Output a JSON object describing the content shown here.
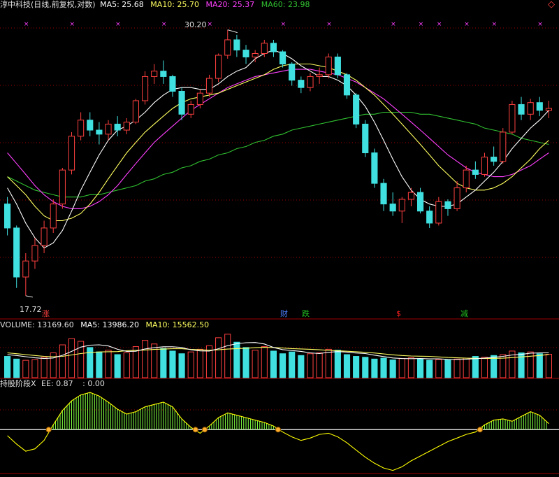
{
  "header": {
    "title": "淳中科技(日线,前复权,对数)",
    "ma5_label": "MA5: 25.68",
    "ma10_label": "MA10: 25.70",
    "ma20_label": "MA20: 25.37",
    "ma60_label": "MA60: 23.98",
    "corner_icon": "diamond-icon"
  },
  "price_panel": {
    "high_annotation": "30.20",
    "low_annotation": "17.72",
    "markers": [
      {
        "label": "涨",
        "color": "#ff4040"
      },
      {
        "label": "财",
        "color": "#4a7fff"
      },
      {
        "label": "跌",
        "color": "#20c020"
      },
      {
        "label": "$",
        "color": "#ff2020"
      },
      {
        "label": "减",
        "color": "#20c020"
      }
    ]
  },
  "volume_panel": {
    "volume_label": "VOLUME: 13169.60",
    "ma5_label": "MA5: 13986.20",
    "ma10_label": "MA10: 15562.50"
  },
  "indicator_panel": {
    "name_label": "持股阶段X",
    "ee_label": "EE: 0.87",
    "value_label": ": 0.00"
  },
  "colors": {
    "up": "#ff4040",
    "down": "#40e0e0",
    "ma5": "#ffffff",
    "ma10": "#ffff60",
    "ma20": "#ff40ff",
    "ma60": "#30c030",
    "indicator_line": "#ffff00",
    "indicator_bars": "#80ff40",
    "grid": "#a00000"
  },
  "chart_data": {
    "type": "candlestick",
    "title": "淳中科技(日线,前复权,对数)",
    "y_range": [
      17.72,
      30.2
    ],
    "ohlc": [
      [
        21.3,
        21.6,
        20.0,
        20.3
      ],
      [
        20.3,
        20.4,
        18.0,
        18.4
      ],
      [
        18.4,
        19.3,
        17.72,
        19.0
      ],
      [
        19.0,
        19.9,
        18.7,
        19.6
      ],
      [
        19.6,
        20.6,
        19.3,
        20.3
      ],
      [
        20.3,
        21.5,
        20.1,
        21.3
      ],
      [
        21.3,
        22.9,
        21.1,
        22.8
      ],
      [
        22.8,
        24.6,
        22.6,
        24.4
      ],
      [
        24.4,
        25.6,
        24.2,
        25.2
      ],
      [
        25.2,
        25.6,
        24.4,
        24.7
      ],
      [
        24.7,
        25.1,
        24.0,
        24.5
      ],
      [
        24.5,
        25.2,
        24.2,
        25.0
      ],
      [
        25.0,
        25.4,
        24.4,
        24.7
      ],
      [
        24.7,
        25.3,
        24.5,
        25.1
      ],
      [
        25.1,
        26.3,
        25.0,
        26.2
      ],
      [
        26.2,
        27.8,
        26.0,
        27.5
      ],
      [
        27.5,
        28.2,
        27.1,
        27.8
      ],
      [
        27.8,
        28.4,
        27.1,
        27.5
      ],
      [
        27.5,
        27.6,
        26.4,
        26.7
      ],
      [
        26.7,
        26.9,
        25.2,
        25.5
      ],
      [
        25.5,
        26.2,
        25.3,
        26.0
      ],
      [
        26.0,
        26.8,
        25.8,
        26.6
      ],
      [
        26.6,
        27.6,
        26.4,
        27.4
      ],
      [
        27.4,
        28.8,
        27.2,
        28.7
      ],
      [
        28.7,
        30.2,
        28.5,
        29.6
      ],
      [
        29.6,
        29.9,
        28.6,
        29.0
      ],
      [
        29.0,
        29.3,
        28.2,
        28.6
      ],
      [
        28.6,
        29.0,
        28.3,
        28.8
      ],
      [
        28.8,
        29.6,
        28.6,
        29.4
      ],
      [
        29.4,
        29.6,
        28.6,
        28.9
      ],
      [
        28.9,
        29.0,
        28.0,
        28.2
      ],
      [
        28.2,
        28.3,
        27.0,
        27.3
      ],
      [
        27.3,
        27.5,
        26.6,
        26.9
      ],
      [
        26.9,
        27.7,
        26.7,
        27.5
      ],
      [
        27.5,
        28.0,
        27.1,
        27.6
      ],
      [
        27.6,
        28.8,
        27.4,
        28.6
      ],
      [
        28.6,
        28.8,
        27.4,
        27.6
      ],
      [
        27.6,
        27.7,
        26.3,
        26.5
      ],
      [
        26.5,
        26.6,
        24.8,
        25.0
      ],
      [
        25.0,
        25.2,
        23.4,
        23.6
      ],
      [
        23.6,
        23.8,
        22.0,
        22.2
      ],
      [
        22.2,
        22.4,
        21.0,
        21.3
      ],
      [
        21.3,
        21.8,
        20.8,
        21.0
      ],
      [
        21.0,
        21.6,
        20.5,
        21.5
      ],
      [
        21.5,
        22.0,
        21.2,
        21.8
      ],
      [
        21.8,
        22.0,
        20.9,
        21.0
      ],
      [
        21.0,
        21.2,
        20.3,
        20.5
      ],
      [
        20.5,
        21.6,
        20.4,
        21.4
      ],
      [
        21.4,
        21.5,
        20.8,
        21.1
      ],
      [
        21.1,
        22.3,
        21.0,
        22.0
      ],
      [
        22.0,
        23.0,
        21.8,
        22.8
      ],
      [
        22.8,
        23.2,
        22.4,
        22.6
      ],
      [
        22.6,
        23.6,
        22.5,
        23.4
      ],
      [
        23.4,
        23.9,
        23.0,
        23.2
      ],
      [
        23.2,
        24.8,
        23.1,
        24.6
      ],
      [
        24.6,
        26.2,
        24.5,
        26.0
      ],
      [
        26.0,
        26.4,
        25.2,
        25.5
      ],
      [
        25.5,
        26.3,
        25.2,
        26.1
      ],
      [
        26.1,
        26.4,
        25.4,
        25.7
      ],
      [
        25.7,
        26.2,
        25.3,
        25.8
      ]
    ],
    "ma5": [
      22.0,
      21.3,
      20.5,
      19.9,
      19.5,
      19.7,
      20.2,
      21.0,
      21.9,
      22.7,
      23.5,
      24.2,
      24.7,
      24.9,
      25.2,
      25.6,
      26.1,
      26.5,
      26.8,
      26.9,
      26.9,
      26.8,
      26.8,
      27.1,
      27.5,
      27.8,
      28.0,
      28.5,
      28.8,
      29.0,
      28.8,
      28.5,
      28.1,
      27.8,
      27.5,
      27.5,
      27.3,
      27.0,
      26.5,
      25.9,
      25.1,
      24.2,
      23.3,
      22.5,
      21.9,
      21.5,
      21.3,
      21.2,
      21.2,
      21.3,
      21.6,
      21.9,
      22.3,
      22.7,
      23.2,
      23.8,
      24.3,
      24.8,
      25.2,
      25.7
    ],
    "ma10": [
      22.5,
      22.1,
      21.7,
      21.2,
      20.8,
      20.6,
      20.6,
      20.7,
      20.9,
      21.3,
      21.8,
      22.4,
      23.0,
      23.6,
      24.1,
      24.6,
      25.0,
      25.4,
      25.8,
      26.1,
      26.3,
      26.4,
      26.5,
      26.6,
      26.8,
      27.0,
      27.2,
      27.4,
      27.6,
      27.9,
      28.1,
      28.2,
      28.2,
      28.2,
      28.1,
      28.0,
      27.8,
      27.6,
      27.3,
      26.9,
      26.5,
      26.0,
      25.5,
      25.0,
      24.5,
      24.0,
      23.5,
      23.0,
      22.6,
      22.2,
      22.0,
      21.9,
      21.9,
      22.0,
      22.2,
      22.5,
      22.9,
      23.3,
      23.8,
      24.2
    ],
    "ma20": [
      23.6,
      23.1,
      22.6,
      22.1,
      21.7,
      21.4,
      21.2,
      21.1,
      21.1,
      21.2,
      21.4,
      21.7,
      22.1,
      22.6,
      23.1,
      23.6,
      24.1,
      24.5,
      24.9,
      25.3,
      25.7,
      26.0,
      26.3,
      26.6,
      26.9,
      27.1,
      27.3,
      27.5,
      27.6,
      27.7,
      27.8,
      27.9,
      27.9,
      27.9,
      27.8,
      27.7,
      27.6,
      27.4,
      27.2,
      26.9,
      26.6,
      26.3,
      25.9,
      25.5,
      25.1,
      24.7,
      24.3,
      23.9,
      23.5,
      23.2,
      22.9,
      22.7,
      22.6,
      22.5,
      22.5,
      22.6,
      22.8,
      23.0,
      23.3,
      23.6
    ],
    "ma60": [
      22.5,
      22.3,
      22.1,
      21.9,
      21.8,
      21.7,
      21.6,
      21.6,
      21.6,
      21.7,
      21.7,
      21.8,
      21.9,
      22.0,
      22.1,
      22.3,
      22.4,
      22.6,
      22.7,
      22.9,
      23.0,
      23.2,
      23.3,
      23.5,
      23.6,
      23.8,
      23.9,
      24.1,
      24.2,
      24.4,
      24.5,
      24.7,
      24.8,
      24.9,
      25.0,
      25.1,
      25.2,
      25.3,
      25.4,
      25.5,
      25.5,
      25.6,
      25.6,
      25.6,
      25.6,
      25.5,
      25.5,
      25.4,
      25.3,
      25.2,
      25.1,
      25.0,
      24.8,
      24.7,
      24.6,
      24.5,
      24.3,
      24.2,
      24.1,
      24.0
    ],
    "volume": [
      12000,
      10500,
      9800,
      10200,
      11500,
      14000,
      18500,
      22000,
      20500,
      17000,
      14500,
      15500,
      13000,
      14000,
      17500,
      21000,
      19000,
      16500,
      15000,
      13500,
      14500,
      16000,
      18000,
      22500,
      24500,
      20000,
      17000,
      15500,
      17500,
      15000,
      13500,
      14500,
      12500,
      13500,
      14000,
      16000,
      15500,
      13000,
      12000,
      11500,
      10500,
      11000,
      10000,
      10800,
      11200,
      10500,
      9800,
      10200,
      10000,
      10500,
      11000,
      12000,
      11500,
      12500,
      13000,
      15000,
      14000,
      14500,
      13500,
      13169.6
    ],
    "volume_ma5": [
      13000,
      12500,
      11800,
      11200,
      10800,
      11100,
      12600,
      14800,
      17200,
      18300,
      18500,
      17900,
      16000,
      14800,
      14900,
      16200,
      16900,
      17400,
      17400,
      17000,
      15700,
      15100,
      15000,
      16300,
      18100,
      19100,
      19700,
      19800,
      19000,
      17000,
      15800,
      15300,
      14800,
      14000,
      13600,
      14300,
      14700,
      14400,
      13900,
      13600,
      12700,
      11900,
      11100,
      10800,
      10700,
      10800,
      10600,
      10600,
      10300,
      10200,
      10400,
      10700,
      11000,
      11500,
      12000,
      12800,
      13100,
      13800,
      14000,
      13986.2
    ],
    "volume_ma10": [
      14000,
      13500,
      13000,
      12500,
      12000,
      11800,
      12000,
      12800,
      13600,
      14200,
      14500,
      14600,
      14700,
      15200,
      15400,
      15600,
      15900,
      16100,
      16300,
      16300,
      15900,
      15700,
      15500,
      15700,
      16100,
      16400,
      16600,
      16900,
      17100,
      17000,
      16700,
      16400,
      16200,
      16000,
      15700,
      15400,
      15200,
      14900,
      14600,
      14300,
      13900,
      13400,
      12900,
      12500,
      12200,
      12100,
      12000,
      11700,
      11400,
      11200,
      11000,
      10900,
      10800,
      10900,
      11000,
      11300,
      11700,
      12100,
      12500,
      13100
    ],
    "volume_y_max": 26000,
    "indicator": [
      -0.5,
      -1.2,
      -1.8,
      -1.6,
      -0.9,
      0.4,
      1.6,
      2.4,
      2.9,
      3.1,
      2.8,
      2.3,
      1.7,
      1.3,
      1.5,
      1.9,
      2.1,
      2.3,
      1.9,
      0.9,
      0.2,
      -0.3,
      0.3,
      1.0,
      1.4,
      1.2,
      1.0,
      0.8,
      0.6,
      0.3,
      -0.2,
      -0.6,
      -0.9,
      -0.7,
      -0.4,
      -0.3,
      -0.6,
      -1.1,
      -1.7,
      -2.3,
      -2.8,
      -3.2,
      -3.4,
      -3.1,
      -2.6,
      -2.2,
      -1.8,
      -1.4,
      -1.0,
      -0.7,
      -0.4,
      -0.2,
      0.4,
      0.8,
      0.9,
      0.7,
      1.1,
      1.5,
      1.2,
      0.5
    ],
    "indicator_range": [
      -3.6,
      3.4
    ]
  }
}
